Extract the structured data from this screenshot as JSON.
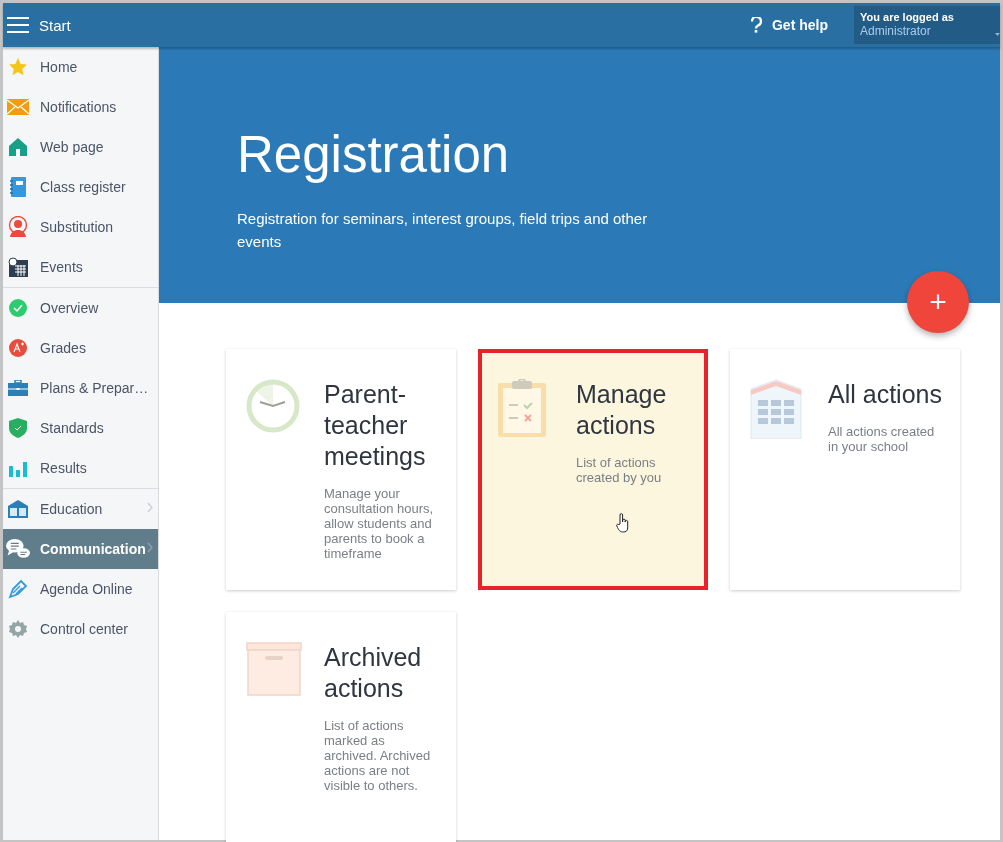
{
  "topbar": {
    "title": "Start",
    "help": "Get help",
    "user_caption": "You are logged as",
    "user_name": "Administrator"
  },
  "sidebar": {
    "groups": [
      [
        {
          "label": "Home",
          "kind": "star",
          "selected": false,
          "chevron": false
        },
        {
          "label": "Notifications",
          "kind": "envelope",
          "selected": false,
          "chevron": false
        },
        {
          "label": "Web page",
          "kind": "house",
          "selected": false,
          "chevron": false
        },
        {
          "label": "Class register",
          "kind": "notebook",
          "selected": false,
          "chevron": false
        },
        {
          "label": "Substitution",
          "kind": "person",
          "selected": false,
          "chevron": false
        },
        {
          "label": "Events",
          "kind": "calendar",
          "selected": false,
          "chevron": false
        }
      ],
      [
        {
          "label": "Overview",
          "kind": "check",
          "selected": false,
          "chevron": false
        },
        {
          "label": "Grades",
          "kind": "grade",
          "selected": false,
          "chevron": false
        },
        {
          "label": "Plans & Prepar…",
          "kind": "briefcase",
          "selected": false,
          "chevron": false
        },
        {
          "label": "Standards",
          "kind": "shield",
          "selected": false,
          "chevron": false
        },
        {
          "label": "Results",
          "kind": "bars",
          "selected": false,
          "chevron": false
        }
      ],
      [
        {
          "label": "Education",
          "kind": "book",
          "selected": false,
          "chevron": true
        },
        {
          "label": "Communication",
          "kind": "chat",
          "selected": true,
          "chevron": true
        },
        {
          "label": "Agenda Online",
          "kind": "pen",
          "selected": false,
          "chevron": false
        },
        {
          "label": "Control center",
          "kind": "gear",
          "selected": false,
          "chevron": false
        }
      ]
    ]
  },
  "hero": {
    "title": "Registration",
    "subtitle": "Registration for seminars, interest groups, field trips and other events",
    "add_button": "+"
  },
  "cards": [
    {
      "title": "Parent-teacher meetings",
      "description": "Manage your consultation hours, allow students and parents to book a timeframe",
      "kind": "clock",
      "highlighted": false
    },
    {
      "title": "Manage actions",
      "description": "List of actions created by you",
      "kind": "clipboard",
      "highlighted": true
    },
    {
      "title": "All actions",
      "description": "All actions created in your school",
      "kind": "building",
      "highlighted": false
    },
    {
      "title": "Archived actions",
      "description": "List of actions marked as archived. Archived actions are not visible to others.",
      "kind": "box",
      "highlighted": false
    }
  ]
}
